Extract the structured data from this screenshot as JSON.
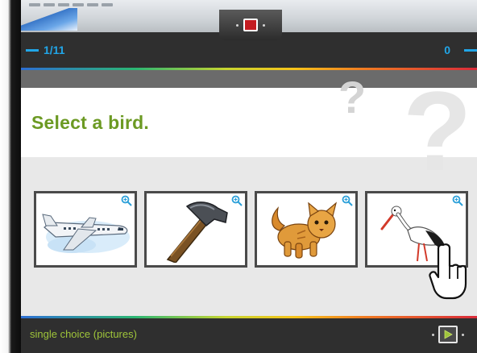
{
  "header": {
    "progress": "1/11",
    "score": "0"
  },
  "question": {
    "text": "Select a bird."
  },
  "answers": [
    {
      "icon": "airplane-icon"
    },
    {
      "icon": "hammer-icon"
    },
    {
      "icon": "cat-icon"
    },
    {
      "icon": "stork-icon"
    }
  ],
  "footer": {
    "question_type": "single choice (pictures)"
  },
  "colors": {
    "accent_blue": "#21a6e8",
    "question_green": "#6c9a23",
    "footer_green": "#9fc53a",
    "bar_dark": "#2f2f2f"
  }
}
